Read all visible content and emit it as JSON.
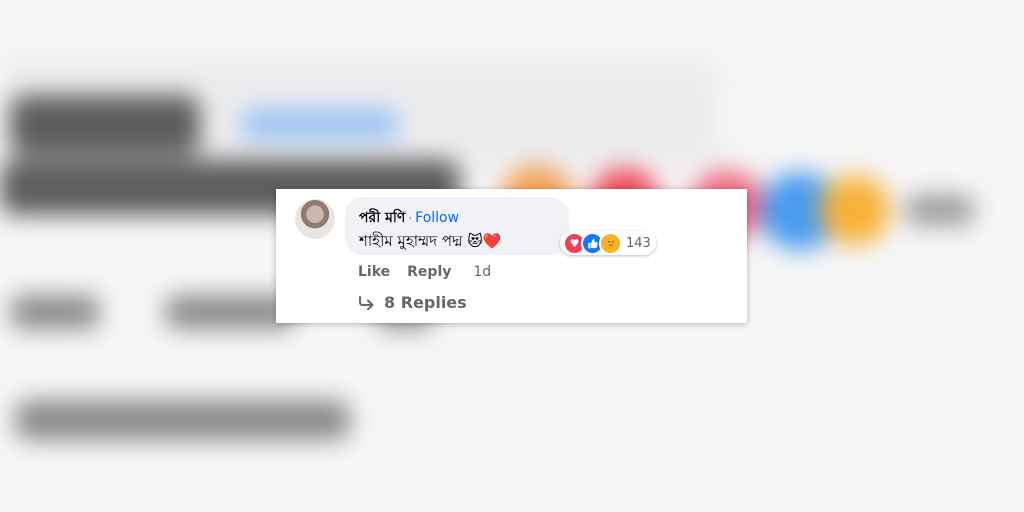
{
  "comment": {
    "author_name": "পরী মণি",
    "separator": "·",
    "follow_label": "Follow",
    "text": "শাহীম মুহাম্মদ পদ্ম",
    "emojis": "😻❤️",
    "reactions": {
      "icons": [
        "love-icon",
        "like-icon",
        "care-icon"
      ],
      "count": "143"
    },
    "actions": {
      "like_label": "Like",
      "reply_label": "Reply",
      "time": "1d"
    },
    "replies_label": "8 Replies"
  },
  "colors": {
    "link_blue": "#0866ff",
    "bubble_bg": "#f0f2f5",
    "secondary_text": "#65676b",
    "love_red": "#f33e58",
    "like_blue": "#1877f2",
    "care_yellow": "#f7b125"
  }
}
